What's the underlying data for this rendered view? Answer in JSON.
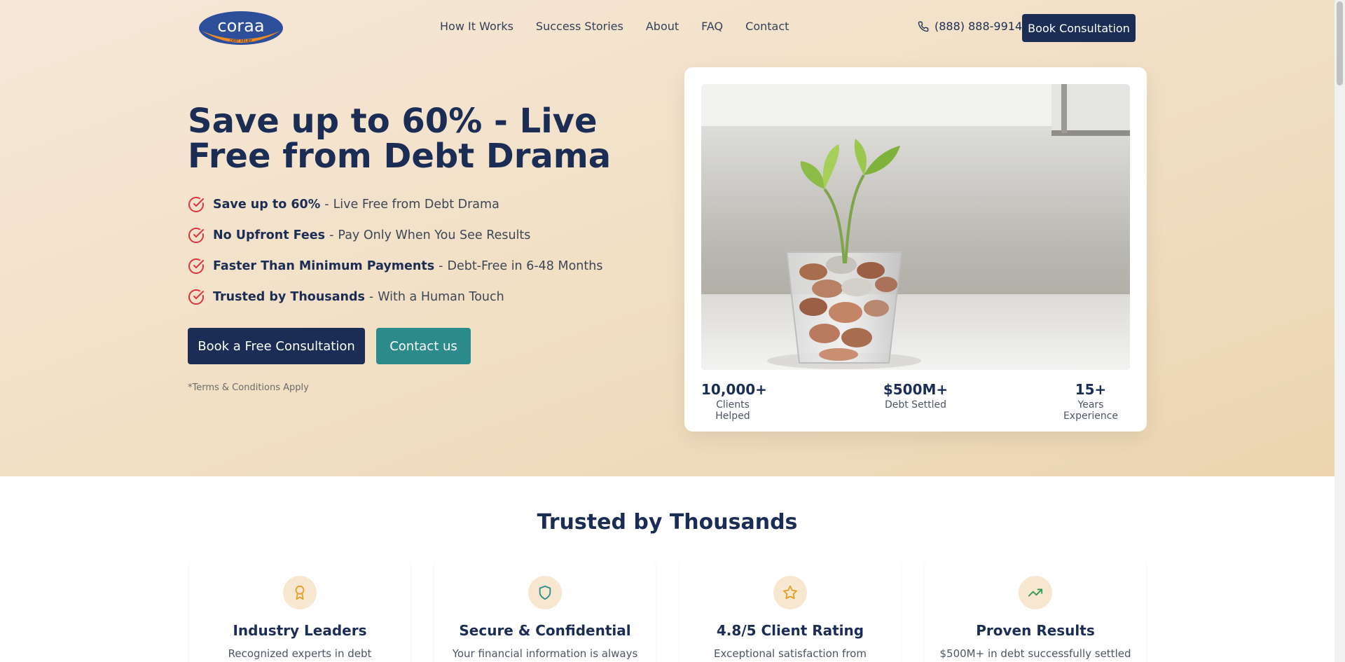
{
  "brand": {
    "name": "coraa",
    "tagline": "DEBT RELIEF"
  },
  "nav": {
    "items": [
      "How It Works",
      "Success Stories",
      "About",
      "FAQ",
      "Contact"
    ]
  },
  "header": {
    "phone": "(888) 888-9914",
    "book_label": "Book Consultation"
  },
  "hero": {
    "title": "Save up to 60% - Live Free from Debt Drama",
    "features": [
      {
        "bold": "Save up to 60%",
        "rest": "Live Free from Debt Drama"
      },
      {
        "bold": "No Upfront Fees",
        "rest": "Pay Only When You See Results"
      },
      {
        "bold": "Faster Than Minimum Payments",
        "rest": "Debt-Free in 6-48 Months"
      },
      {
        "bold": "Trusted by Thousands",
        "rest": "With a Human Touch"
      }
    ],
    "cta_primary": "Book a Free Consultation",
    "cta_secondary": "Contact us",
    "terms": "*Terms & Conditions Apply"
  },
  "stats": [
    {
      "value": "10,000+",
      "label": "Clients Helped"
    },
    {
      "value": "$500M+",
      "label": "Debt Settled"
    },
    {
      "value": "15+",
      "label": "Years Experience"
    }
  ],
  "trusted": {
    "title": "Trusted by Thousands",
    "cards": [
      {
        "title": "Industry Leaders",
        "desc": "Recognized experts in debt",
        "icon": "award-icon"
      },
      {
        "title": "Secure & Confidential",
        "desc": "Your financial information is always",
        "icon": "shield-icon"
      },
      {
        "title": "4.8/5 Client Rating",
        "desc": "Exceptional satisfaction from",
        "icon": "star-icon"
      },
      {
        "title": "Proven Results",
        "desc": "$500M+ in debt successfully settled",
        "icon": "trending-up-icon"
      }
    ]
  },
  "colors": {
    "navy": "#1b2d55",
    "teal": "#2b8b8a",
    "check_red": "#d9363e",
    "logo_orange": "#f08a24"
  }
}
